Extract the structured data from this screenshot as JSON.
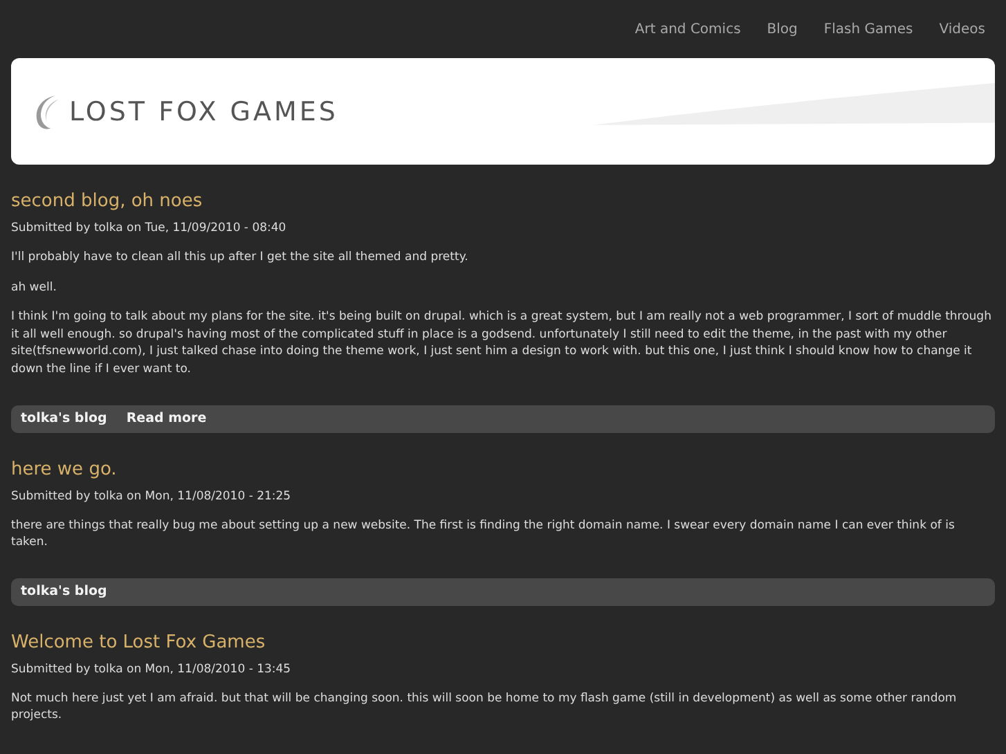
{
  "nav": [
    "Art and Comics",
    "Blog",
    "Flash Games",
    "Videos"
  ],
  "site_name": "LOST FOX GAMES",
  "posts": [
    {
      "title": "second blog, oh noes",
      "meta": "Submitted by tolka on Tue, 11/09/2010 - 08:40",
      "paragraphs": [
        "I'll probably have to clean all this up after I get the site all themed and pretty.",
        "ah well.",
        "I think I'm going to talk about my plans for the site. it's being built on drupal. which is a great system, but I am really not a web programmer, I sort of muddle through it all well enough. so drupal's having most of the complicated stuff in place is a godsend. unfortunately I still need to edit the theme, in the past with my other site(tfsnewworld.com), I just talked chase into doing the theme work, I just sent him a design to work with. but this one, I just think I should know how to change it down the line if I ever want to."
      ],
      "links": [
        "tolka's blog",
        "Read more"
      ]
    },
    {
      "title": "here we go.",
      "meta": "Submitted by tolka on Mon, 11/08/2010 - 21:25",
      "paragraphs": [
        "there are things that really bug me about setting up a new website. The first is finding the right domain name. I swear every domain name I can ever think of is taken."
      ],
      "links": [
        "tolka's blog"
      ]
    },
    {
      "title": "Welcome to Lost Fox Games",
      "meta": "Submitted by tolka on Mon, 11/08/2010 - 13:45",
      "paragraphs": [
        "Not much here just yet I am afraid. but that will be changing soon. this will soon be home to my flash game (still in development) as well as some other random projects."
      ]
    }
  ]
}
